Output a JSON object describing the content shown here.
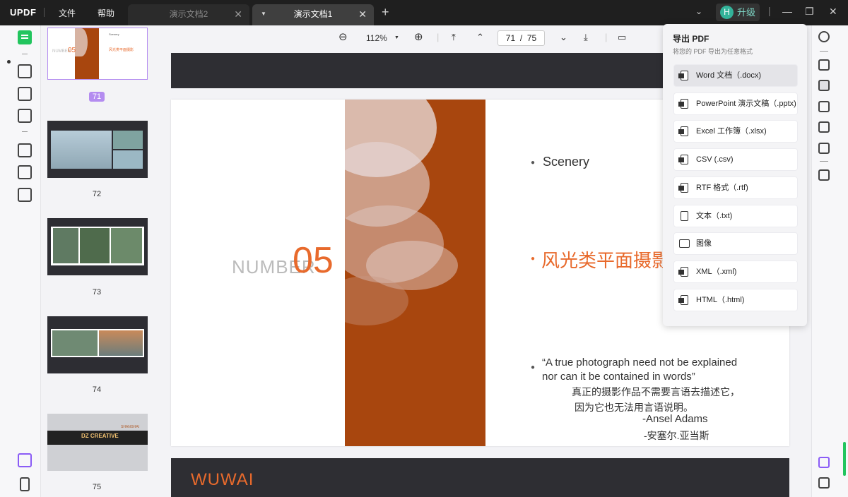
{
  "app": {
    "logo": "UPDF",
    "menus": [
      "文件",
      "帮助"
    ]
  },
  "tabs": [
    {
      "label": "演示文档2",
      "active": false
    },
    {
      "label": "演示文档1",
      "active": true
    }
  ],
  "upgrade": {
    "avatar": "H",
    "label": "升级"
  },
  "toolbar": {
    "zoom": "112%",
    "current_page": "71",
    "page_sep": "/",
    "total_pages": "75"
  },
  "thumbnails": [
    {
      "num": "71",
      "selected": true
    },
    {
      "num": "72"
    },
    {
      "num": "73"
    },
    {
      "num": "74"
    },
    {
      "num": "75"
    }
  ],
  "page71": {
    "number_label": "NUMBER",
    "number_value": "05",
    "bullet1": "Scenery",
    "bullet2": "风光类平面摄影",
    "quote": "“A true photograph need not be explained nor can it be contained in words”",
    "cn_line1": "真正的摄影作品不需要言语去描述它，",
    "cn_line2": "因为它也无法用言语说明。",
    "author_en": "-Ansel Adams",
    "author_cn": "-安塞尔.亚当斯"
  },
  "next_page": {
    "title": "WUWAI"
  },
  "export_panel": {
    "title": "导出 PDF",
    "subtitle": "将您的 PDF 导出为任意格式",
    "options": [
      {
        "label": "Word 文档（.docx)",
        "icon": "word-icon"
      },
      {
        "label": "PowerPoint 演示文稿（.pptx)",
        "icon": "powerpoint-icon"
      },
      {
        "label": "Excel 工作簿（.xlsx)",
        "icon": "excel-icon"
      },
      {
        "label": "CSV (.csv)",
        "icon": "csv-icon"
      },
      {
        "label": "RTF 格式（.rtf)",
        "icon": "rtf-icon"
      },
      {
        "label": "文本（.txt)",
        "icon": "text-icon"
      },
      {
        "label": "图像",
        "icon": "image-icon"
      },
      {
        "label": "XML（.xml)",
        "icon": "xml-icon"
      },
      {
        "label": "HTML（.html)",
        "icon": "html-icon"
      }
    ]
  },
  "thumb_texts": {
    "t71_number": "NUMBER",
    "t71_05": "05",
    "t71_s": "Scenery",
    "t71_fg": "风光类平面摄影",
    "t75_shanghai": "SHANGHAI",
    "t75_creative": "DZ CREATIVE"
  },
  "colors": {
    "accent": "#e86a2c",
    "brand": "#22c55e",
    "selection": "#b48cf0"
  }
}
